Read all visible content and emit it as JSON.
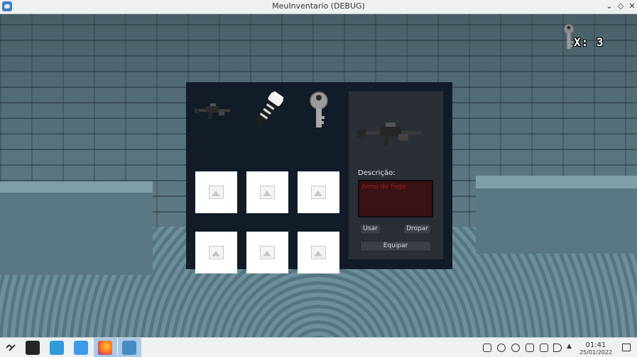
{
  "window": {
    "title": "MeuInventario (DEBUG)"
  },
  "hud": {
    "key_count": "X: 3",
    "key_icon": "key-icon"
  },
  "inventory": {
    "equipped": [
      {
        "icon": "rifle-icon"
      },
      {
        "icon": "flashlight-icon"
      },
      {
        "icon": "key-icon"
      }
    ],
    "slots": [
      {
        "icon": "image-placeholder-icon"
      },
      {
        "icon": "image-placeholder-icon"
      },
      {
        "icon": "image-placeholder-icon"
      },
      {
        "icon": "image-placeholder-icon"
      },
      {
        "icon": "image-placeholder-icon"
      },
      {
        "icon": "image-placeholder-icon"
      }
    ],
    "detail": {
      "preview_icon": "rifle-icon",
      "description_label": "Descrição:",
      "description_text": "Arma de Fogo",
      "use_label": "Usar",
      "drop_label": "Dropar",
      "equip_label": "Equipar"
    }
  },
  "taskbar": {
    "apps": [
      "launcher-icon",
      "terminal-icon",
      "discover-icon",
      "file-manager-icon",
      "firefox-icon",
      "godot-icon"
    ],
    "clock": {
      "time": "01:41",
      "date": "25/01/2022"
    }
  },
  "colors": {
    "panel": "#111c28",
    "detail_panel": "#2a2e35",
    "description_text": "#a01c1c"
  }
}
